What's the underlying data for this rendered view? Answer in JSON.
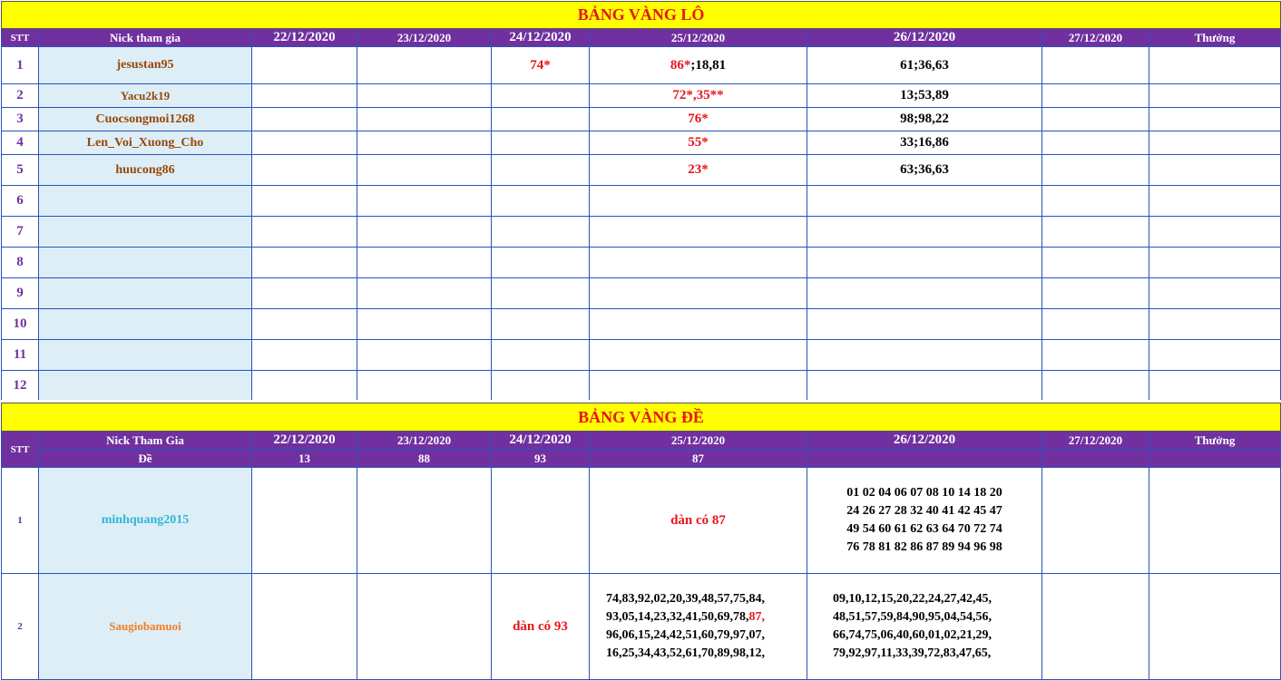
{
  "lo": {
    "title": "BẢNG VÀNG LÔ",
    "headers": [
      "STT",
      "Nick tham gia",
      "22/12/2020",
      "23/12/2020",
      "24/12/2020",
      "25/12/2020",
      "26/12/2020",
      "27/12/2020",
      "Thưởng"
    ],
    "rows": [
      {
        "stt": "1",
        "nick": "jesustan95",
        "d24": "74*",
        "d25_red": "86*",
        "d25_black": ";18,81",
        "d26": "61;36,63"
      },
      {
        "stt": "2",
        "nick": "Yacu2k19",
        "d25_red": "72*,35**",
        "d26": "13;53,89"
      },
      {
        "stt": "3",
        "nick": "Cuocsongmoi1268",
        "d25_red": "76*",
        "d26": "98;98,22"
      },
      {
        "stt": "4",
        "nick": "Len_Voi_Xuong_Cho",
        "d25_red": "55*",
        "d26": "33;16,86"
      },
      {
        "stt": "5",
        "nick": "huucong86",
        "d25_red": "23*",
        "d26": "63;36,63"
      },
      {
        "stt": "6"
      },
      {
        "stt": "7"
      },
      {
        "stt": "8"
      },
      {
        "stt": "9"
      },
      {
        "stt": "10"
      },
      {
        "stt": "11"
      },
      {
        "stt": "12"
      }
    ]
  },
  "de": {
    "title": "BẢNG VÀNG ĐỀ",
    "headers": [
      "STT",
      "Nick Tham Gia",
      "22/12/2020",
      "23/12/2020",
      "24/12/2020",
      "25/12/2020",
      "26/12/2020",
      "27/12/2020",
      "Thưởng"
    ],
    "sub_label": "Đề",
    "sub_values": [
      "13",
      "88",
      "93",
      "87"
    ],
    "rows": [
      {
        "stt": "1",
        "nick": "minhquang2015",
        "d25": "dàn có 87",
        "d26_lines": [
          "01 02 04 06 07 08 10 14 18 20",
          "24 26 27 28 32 40 41 42 45 47",
          "49 54 60 61 62 63 64 70 72 74",
          "76 78 81 82 86 87 89 94 96 98"
        ]
      },
      {
        "stt": "2",
        "nick": "Saugiobamuoi",
        "d24": "dàn có 93",
        "d25_line1_a": "74,83,92,02,20,39,48,57,75,84,",
        "d25_line2_a": "93,05,14,23,32,41,50,69,78,",
        "d25_line2_red": "87,",
        "d25_line3": "96,06,15,24,42,51,60,79,97,07,",
        "d25_line4": "16,25,34,43,52,61,70,89,98,12,",
        "d26_lines": [
          "09,10,12,15,20,22,24,27,42,45,",
          "48,51,57,59,84,90,95,04,54,56,",
          "66,74,75,06,40,60,01,02,21,29,",
          "79,92,97,11,33,39,72,83,47,65,"
        ]
      }
    ]
  }
}
